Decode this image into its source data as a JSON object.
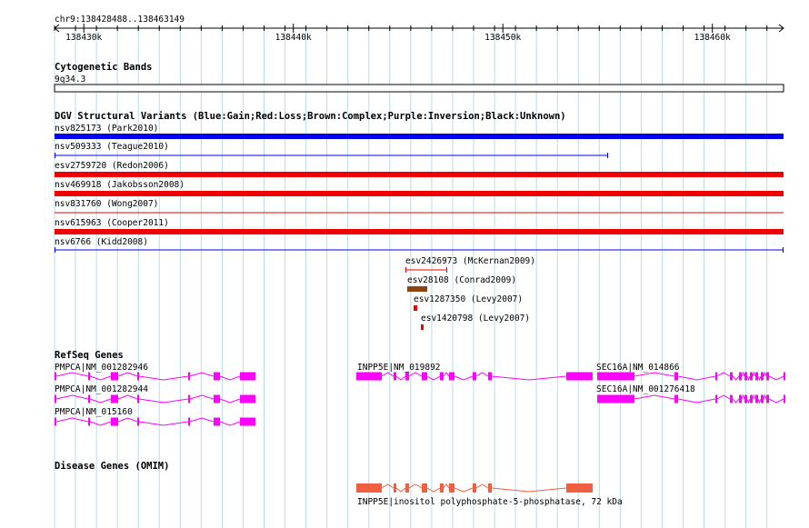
{
  "ruler": {
    "position": "chr9:138428488..138463149",
    "ticks": [
      {
        "label": "138430k",
        "bp": 138430000
      },
      {
        "label": "138440k",
        "bp": 138440000
      },
      {
        "label": "138450k",
        "bp": 138450000
      },
      {
        "label": "138460k",
        "bp": 138460000
      }
    ]
  },
  "tracks": {
    "cytoband": {
      "title": "Cytogenetic Bands",
      "band": "9q34.3"
    },
    "dgv": {
      "title": "DGV Structural Variants (Blue:Gain;Red:Loss;Brown:Complex;Purple:Inversion;Black:Unknown)",
      "colors": {
        "gain": "#0000dd",
        "loss": "#ee0000",
        "complex": "#8b4513",
        "inversion": "#800080",
        "unknown": "#000000"
      },
      "variants": [
        {
          "label": "nsv825173 (Park2010)",
          "color": "#0000ee",
          "style": "thick"
        },
        {
          "label": "nsv509333 (Teague2010)",
          "color": "#0000ee",
          "style": "thin"
        },
        {
          "label": "esv2759720 (Redon2006)",
          "color": "#ee0000",
          "style": "thick"
        },
        {
          "label": "nsv469918 (Jakobsson2008)",
          "color": "#ee0000",
          "style": "thick"
        },
        {
          "label": "nsv831760 (Wong2007)",
          "color": "#ee0000",
          "style": "thin"
        },
        {
          "label": "nsv615963 (Cooper2011)",
          "color": "#ee0000",
          "style": "thick"
        },
        {
          "label": "nsv6766 (Kidd2008)",
          "color": "#0000ee",
          "style": "thin"
        },
        {
          "label": "esv2426973 (McKernan2009)",
          "color": "#ee0000",
          "style": "thin"
        },
        {
          "label": "esv28108 (Conrad2009)",
          "color": "#8b4513",
          "style": "thick"
        },
        {
          "label": "esv1287350 (Levy2007)",
          "color": "#ee0000",
          "style": "thick"
        },
        {
          "label": "esv1420798 (Levy2007)",
          "color": "#ee0000",
          "style": "thick"
        }
      ]
    },
    "refseq": {
      "title": "RefSeq Genes",
      "color": "#ff00ff",
      "genes": [
        {
          "label": "PMPCA|NM_001282946"
        },
        {
          "label": "PMPCA|NM_001282944"
        },
        {
          "label": "PMPCA|NM_015160"
        },
        {
          "label": "INPP5E|NM_019892"
        },
        {
          "label": "SEC16A|NM_014866"
        },
        {
          "label": "SEC16A|NM_001276418"
        }
      ]
    },
    "omim": {
      "title": "Disease Genes (OMIM)",
      "color": "#f06040",
      "label_color": "#000080",
      "gene": {
        "label": "INPP5E|inositol polyphosphate-5-phosphatase, 72 kDa"
      }
    }
  }
}
